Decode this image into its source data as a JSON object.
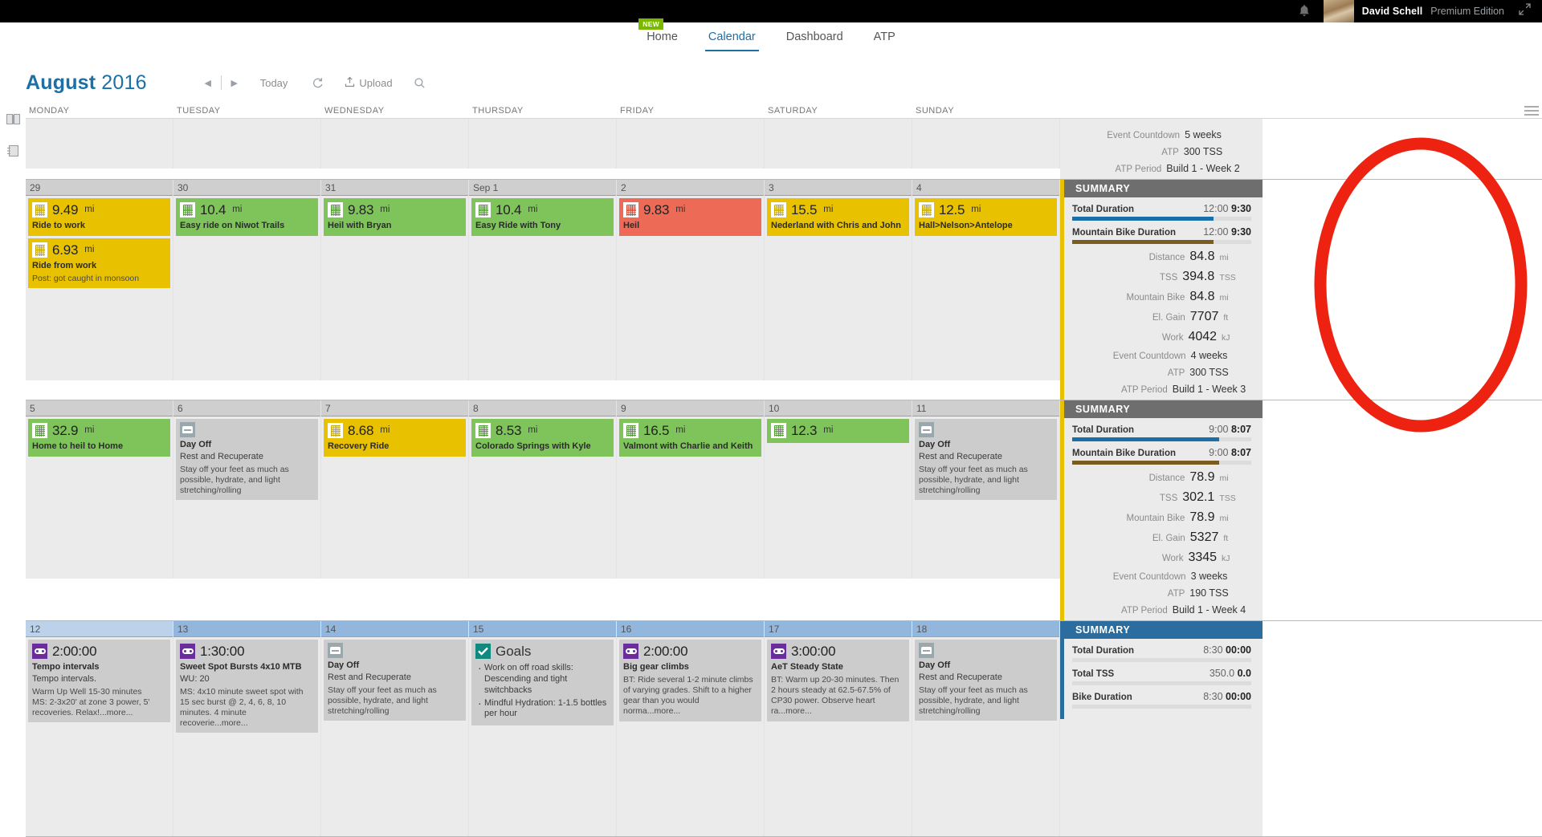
{
  "topbar": {
    "bell_icon": "bell-icon",
    "user_name": "David Schell",
    "edition": "Premium Edition",
    "expand_icon": "expand-icon"
  },
  "nav": {
    "new_badge": "NEW",
    "items": [
      {
        "label": "Home",
        "active": false
      },
      {
        "label": "Calendar",
        "active": true
      },
      {
        "label": "Dashboard",
        "active": false
      },
      {
        "label": "ATP",
        "active": false
      }
    ]
  },
  "toolbar": {
    "month": "August",
    "year": "2016",
    "prev_icon": "prev-arrow-icon",
    "next_icon": "next-arrow-icon",
    "today_label": "Today",
    "refresh_icon": "refresh-icon",
    "upload_label": "Upload",
    "upload_icon": "upload-icon",
    "search_icon": "search-icon"
  },
  "rail": {
    "library_icon": "library-book-icon",
    "notes_icon": "notes-panel-icon"
  },
  "calendar": {
    "day_headers": [
      "MONDAY",
      "TUESDAY",
      "WEDNESDAY",
      "THURSDAY",
      "FRIDAY",
      "SATURDAY",
      "SUNDAY"
    ],
    "menu_icon": "hamburger-menu-icon",
    "top_strip": {
      "event_countdown_label": "Event Countdown",
      "event_countdown_value": "5 weeks",
      "atp_label": "ATP",
      "atp_value": "300 TSS",
      "atp_period_label": "ATP Period",
      "atp_period_value": "Build 1 - Week 2"
    },
    "weeks": [
      {
        "header_style": "grey",
        "days": [
          {
            "num": "29",
            "items": [
              {
                "color": "yellow",
                "icon": "bike-icon",
                "value": "9.49",
                "unit": "mi",
                "title": "Ride to work"
              },
              {
                "color": "yellow",
                "icon": "bike-icon",
                "value": "6.93",
                "unit": "mi",
                "title": "Ride from work",
                "note": "Post: got caught in monsoon"
              }
            ]
          },
          {
            "num": "30",
            "items": [
              {
                "color": "green",
                "icon": "bike-icon",
                "value": "10.4",
                "unit": "mi",
                "title": "Easy ride on Niwot Trails"
              }
            ]
          },
          {
            "num": "31",
            "items": [
              {
                "color": "green",
                "icon": "bike-icon",
                "value": "9.83",
                "unit": "mi",
                "title": "Heil with Bryan"
              }
            ]
          },
          {
            "num": "Sep 1",
            "items": [
              {
                "color": "green",
                "icon": "bike-icon",
                "value": "10.4",
                "unit": "mi",
                "title": "Easy Ride with Tony"
              }
            ]
          },
          {
            "num": "2",
            "items": [
              {
                "color": "red",
                "icon": "bike-icon",
                "value": "9.83",
                "unit": "mi",
                "title": "Heil"
              }
            ]
          },
          {
            "num": "3",
            "items": [
              {
                "color": "yellow",
                "icon": "bike-icon",
                "value": "15.5",
                "unit": "mi",
                "title": "Nederland with Chris and John"
              }
            ]
          },
          {
            "num": "4",
            "items": [
              {
                "color": "yellow",
                "icon": "bike-icon",
                "value": "12.5",
                "unit": "mi",
                "title": "Hall>Nelson>Antelope"
              }
            ]
          }
        ],
        "summary": {
          "header": "SUMMARY",
          "header_color": "grey",
          "accent": "#e8c200",
          "bars": [
            {
              "label": "Total Duration",
              "planned": "12:00",
              "actual": "9:30",
              "fill_pct": 79,
              "fill": "blue"
            },
            {
              "label": "Mountain Bike Duration",
              "planned": "12:00",
              "actual": "9:30",
              "fill_pct": 79,
              "fill": "brown"
            }
          ],
          "stats": [
            {
              "k": "Distance",
              "v": "84.8",
              "u": "mi"
            },
            {
              "k": "TSS",
              "v": "394.8",
              "u": "TSS"
            },
            {
              "k": "Mountain Bike",
              "v": "84.8",
              "u": "mi"
            },
            {
              "k": "El. Gain",
              "v": "7707",
              "u": "ft"
            },
            {
              "k": "Work",
              "v": "4042",
              "u": "kJ"
            }
          ],
          "meta": [
            {
              "k": "Event Countdown",
              "v": "4 weeks"
            },
            {
              "k": "ATP",
              "v": "300 TSS"
            },
            {
              "k": "ATP Period",
              "v": "Build 1 - Week 3"
            }
          ]
        }
      },
      {
        "header_style": "grey",
        "days": [
          {
            "num": "5",
            "items": [
              {
                "color": "green",
                "icon": "bike-icon",
                "value": "32.9",
                "unit": "mi",
                "title": "Home to heil to Home"
              }
            ]
          },
          {
            "num": "6",
            "items": [
              {
                "color": "grey",
                "icon": "rest-icon",
                "title": "Day Off",
                "desc": "Rest and Recuperate",
                "note": "Stay off your feet as much as possible, hydrate, and light stretching/rolling"
              }
            ]
          },
          {
            "num": "7",
            "items": [
              {
                "color": "yellow",
                "icon": "bike-icon",
                "value": "8.68",
                "unit": "mi",
                "title": "Recovery Ride"
              }
            ]
          },
          {
            "num": "8",
            "items": [
              {
                "color": "green",
                "icon": "bike-icon",
                "value": "8.53",
                "unit": "mi",
                "title": "Colorado Springs with Kyle"
              }
            ]
          },
          {
            "num": "9",
            "items": [
              {
                "color": "green",
                "icon": "bike-icon",
                "value": "16.5",
                "unit": "mi",
                "title": "Valmont with Charlie and Keith"
              }
            ]
          },
          {
            "num": "10",
            "items": [
              {
                "color": "green",
                "icon": "bike-icon",
                "value": "12.3",
                "unit": "mi",
                "title": ""
              }
            ]
          },
          {
            "num": "11",
            "items": [
              {
                "color": "grey",
                "icon": "rest-icon",
                "title": "Day Off",
                "desc": "Rest and Recuperate",
                "note": "Stay off your feet as much as possible, hydrate, and light stretching/rolling"
              }
            ]
          }
        ],
        "summary": {
          "header": "SUMMARY",
          "header_color": "grey",
          "accent": "#e8c200",
          "bars": [
            {
              "label": "Total Duration",
              "planned": "9:00",
              "actual": "8:07",
              "fill_pct": 82,
              "fill": "blue"
            },
            {
              "label": "Mountain Bike Duration",
              "planned": "9:00",
              "actual": "8:07",
              "fill_pct": 82,
              "fill": "brown"
            }
          ],
          "stats": [
            {
              "k": "Distance",
              "v": "78.9",
              "u": "mi"
            },
            {
              "k": "TSS",
              "v": "302.1",
              "u": "TSS"
            },
            {
              "k": "Mountain Bike",
              "v": "78.9",
              "u": "mi"
            },
            {
              "k": "El. Gain",
              "v": "5327",
              "u": "ft"
            },
            {
              "k": "Work",
              "v": "3345",
              "u": "kJ"
            }
          ],
          "meta": [
            {
              "k": "Event Countdown",
              "v": "3 weeks"
            },
            {
              "k": "ATP",
              "v": "190 TSS"
            },
            {
              "k": "ATP Period",
              "v": "Build 1 - Week 4"
            }
          ]
        }
      },
      {
        "header_style": "blue",
        "days": [
          {
            "num": "12",
            "items": [
              {
                "color": "grey",
                "icon": "planned-icon",
                "value": "2:00:00",
                "title": "Tempo intervals",
                "desc": "Tempo intervals.",
                "note": "Warm Up Well 15-30 minutes\nMS: 2-3x20' at zone 3 power, 5' recoveries. Relax!...more..."
              }
            ]
          },
          {
            "num": "13",
            "items": [
              {
                "color": "grey",
                "icon": "planned-icon",
                "value": "1:30:00",
                "title": "Sweet Spot Bursts 4x10 MTB",
                "desc": "WU: 20",
                "note": "MS: 4x10 minute sweet spot with 15 sec burst @ 2, 4, 6, 8, 10 minutes. 4 minute recoverie...more..."
              }
            ]
          },
          {
            "num": "14",
            "items": [
              {
                "color": "grey",
                "icon": "rest-icon",
                "title": "Day Off",
                "desc": "Rest and Recuperate",
                "note": "Stay off your feet as much as possible, hydrate, and light stretching/rolling"
              }
            ]
          },
          {
            "num": "15",
            "items": [
              {
                "color": "grey",
                "icon": "goals-icon",
                "value": "Goals",
                "bullets": [
                  "Work on off road skills: Descending and tight switchbacks",
                  "Mindful Hydration: 1-1.5 bottles per hour"
                ]
              }
            ]
          },
          {
            "num": "16",
            "items": [
              {
                "color": "grey",
                "icon": "planned-icon",
                "value": "2:00:00",
                "title": "Big gear climbs",
                "note": "BT: Ride several 1-2 minute climbs of varying grades. Shift to a higher gear than you would norma...more..."
              }
            ]
          },
          {
            "num": "17",
            "items": [
              {
                "color": "grey",
                "icon": "planned-icon",
                "value": "3:00:00",
                "title": "AeT Steady State",
                "note": "BT: Warm up 20-30 minutes. Then 2 hours steady at 62.5-67.5% of CP30 power. Observe heart ra...more..."
              }
            ]
          },
          {
            "num": "18",
            "items": [
              {
                "color": "grey",
                "icon": "rest-icon",
                "title": "Day Off",
                "desc": "Rest and Recuperate",
                "note": "Stay off your feet as much as possible, hydrate, and light stretching/rolling"
              }
            ]
          }
        ],
        "summary": {
          "header": "SUMMARY",
          "header_color": "blue",
          "accent": "#2a6d9e",
          "bars": [
            {
              "label": "Total Duration",
              "planned": "8:30",
              "actual": "00:00",
              "fill_pct": 0,
              "fill": "blue"
            },
            {
              "label": "Total TSS",
              "planned": "350.0",
              "actual": "0.0",
              "fill_pct": 0,
              "fill": "blue"
            },
            {
              "label": "Bike Duration",
              "planned": "8:30",
              "actual": "00:00",
              "fill_pct": 0,
              "fill": "blue"
            }
          ],
          "stats": [],
          "meta": []
        }
      }
    ]
  },
  "annotation": {
    "shape": "red-ellipse-highlight",
    "color": "#ee2211"
  }
}
